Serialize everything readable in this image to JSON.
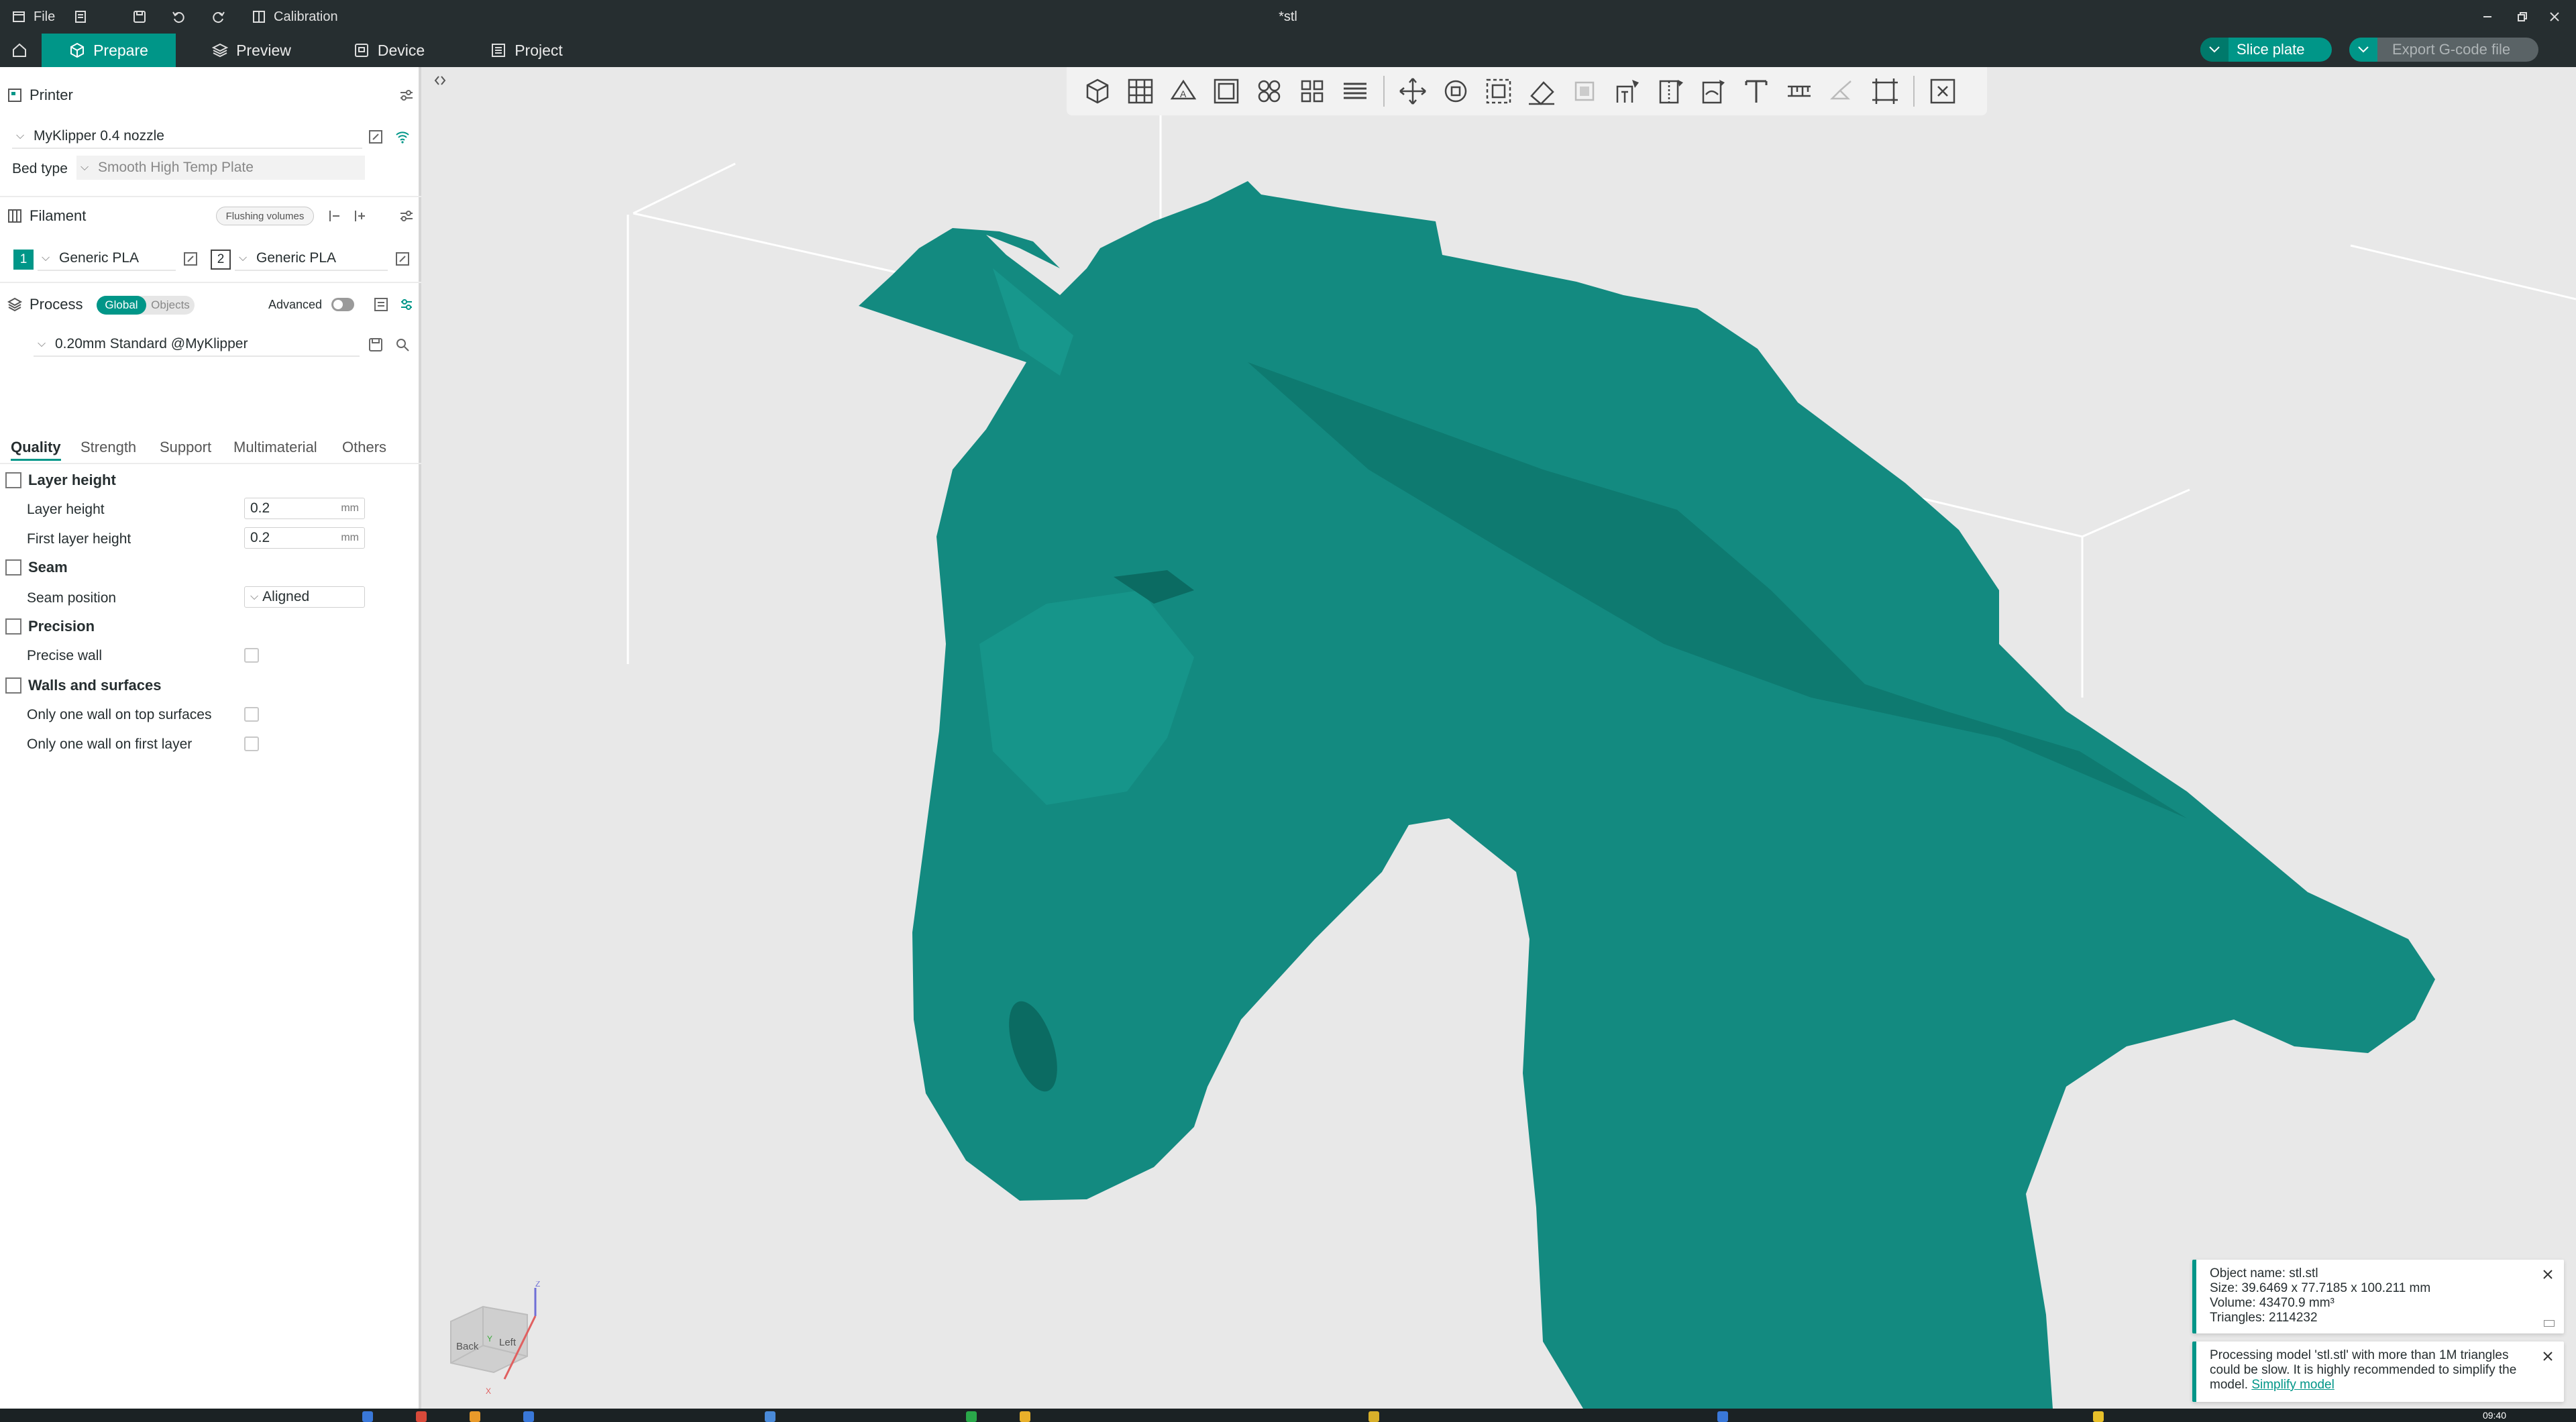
{
  "titlebar": {
    "file_label": "File",
    "calibration_label": "Calibration",
    "document_title": "*stl"
  },
  "tabs": [
    {
      "label": "Prepare",
      "icon": "cube-icon"
    },
    {
      "label": "Preview",
      "icon": "layers-icon"
    },
    {
      "label": "Device",
      "icon": "device-icon"
    },
    {
      "label": "Project",
      "icon": "project-icon"
    }
  ],
  "actions": {
    "slice_label": "Slice plate",
    "export_label": "Export G-code file"
  },
  "printer": {
    "section_title": "Printer",
    "printer_name": "MyKlipper 0.4 nozzle",
    "bed_type_label": "Bed type",
    "bed_type_value": "Smooth High Temp Plate"
  },
  "filament": {
    "section_title": "Filament",
    "flushing_label": "Flushing volumes",
    "slots": [
      {
        "index": "1",
        "name": "Generic PLA",
        "color": "#009688"
      },
      {
        "index": "2",
        "name": "Generic PLA",
        "color": "#ffffff"
      }
    ]
  },
  "process": {
    "section_title": "Process",
    "global_label": "Global",
    "objects_label": "Objects",
    "advanced_label": "Advanced",
    "profile_name": "0.20mm Standard @MyKlipper"
  },
  "quality_tabs": [
    "Quality",
    "Strength",
    "Support",
    "Multimaterial",
    "Others"
  ],
  "options": {
    "layer_height_group": "Layer height",
    "layer_height_label": "Layer height",
    "layer_height_value": "0.2",
    "first_layer_height_label": "First layer height",
    "first_layer_height_value": "0.2",
    "unit_mm": "mm",
    "seam_group": "Seam",
    "seam_position_label": "Seam position",
    "seam_position_value": "Aligned",
    "precision_group": "Precision",
    "precise_wall_label": "Precise wall",
    "walls_group": "Walls and surfaces",
    "one_wall_top_label": "Only one wall on top surfaces",
    "one_wall_first_label": "Only one wall on first layer"
  },
  "navcube": {
    "back_label": "Back",
    "left_label": "Left",
    "z_label": "Z",
    "x_label": "X",
    "y_label": "Y"
  },
  "object_info": {
    "name": "Object name: stl.stl",
    "size": "Size: 39.6469 x 77.7185 x 100.211 mm",
    "volume": "Volume: 43470.9 mm³",
    "triangles": "Triangles: 2114232"
  },
  "warning": {
    "text": "Processing model 'stl.stl' with more than 1M triangles could be slow. It is highly recommended to simplify the model.",
    "link": "Simplify model"
  },
  "taskbar": {
    "clock": "09:40"
  },
  "colors": {
    "accent": "#009688",
    "model": "#138a80",
    "chrome": "#262e30"
  }
}
